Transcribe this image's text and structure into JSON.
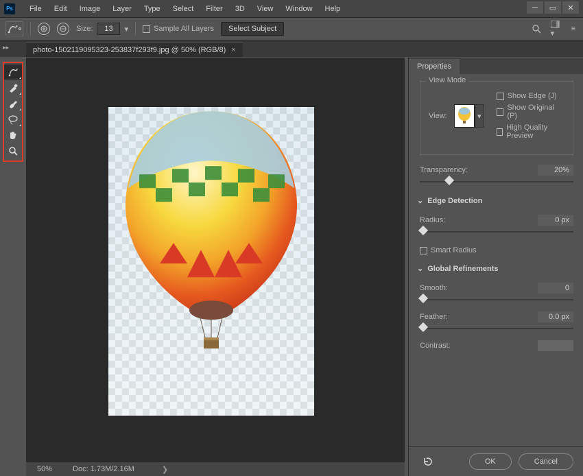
{
  "menu": {
    "items": [
      "File",
      "Edit",
      "Image",
      "Layer",
      "Type",
      "Select",
      "Filter",
      "3D",
      "View",
      "Window",
      "Help"
    ]
  },
  "optionbar": {
    "size_label": "Size:",
    "size_value": "13",
    "sample_all": "Sample All Layers",
    "select_subject": "Select Subject"
  },
  "document": {
    "tab_title": "photo-1502119095323-253837f293f9.jpg @ 50%  (RGB/8)"
  },
  "status": {
    "zoom": "50%",
    "doc": "Doc: 1.73M/2.16M"
  },
  "panel": {
    "title": "Properties",
    "view_mode": {
      "group_title": "View Mode",
      "view_label": "View:",
      "show_edge": "Show Edge (J)",
      "show_original": "Show Original (P)",
      "high_quality": "High Quality Preview"
    },
    "transparency": {
      "label": "Transparency:",
      "value": "20%",
      "pos": 17
    },
    "edge_detection": {
      "title": "Edge Detection",
      "radius_label": "Radius:",
      "radius_value": "0 px",
      "smart_radius": "Smart Radius"
    },
    "global": {
      "title": "Global Refinements",
      "smooth_label": "Smooth:",
      "smooth_value": "0",
      "feather_label": "Feather:",
      "feather_value": "0.0 px",
      "contrast_label": "Contrast:"
    },
    "footer": {
      "ok": "OK",
      "cancel": "Cancel"
    }
  }
}
